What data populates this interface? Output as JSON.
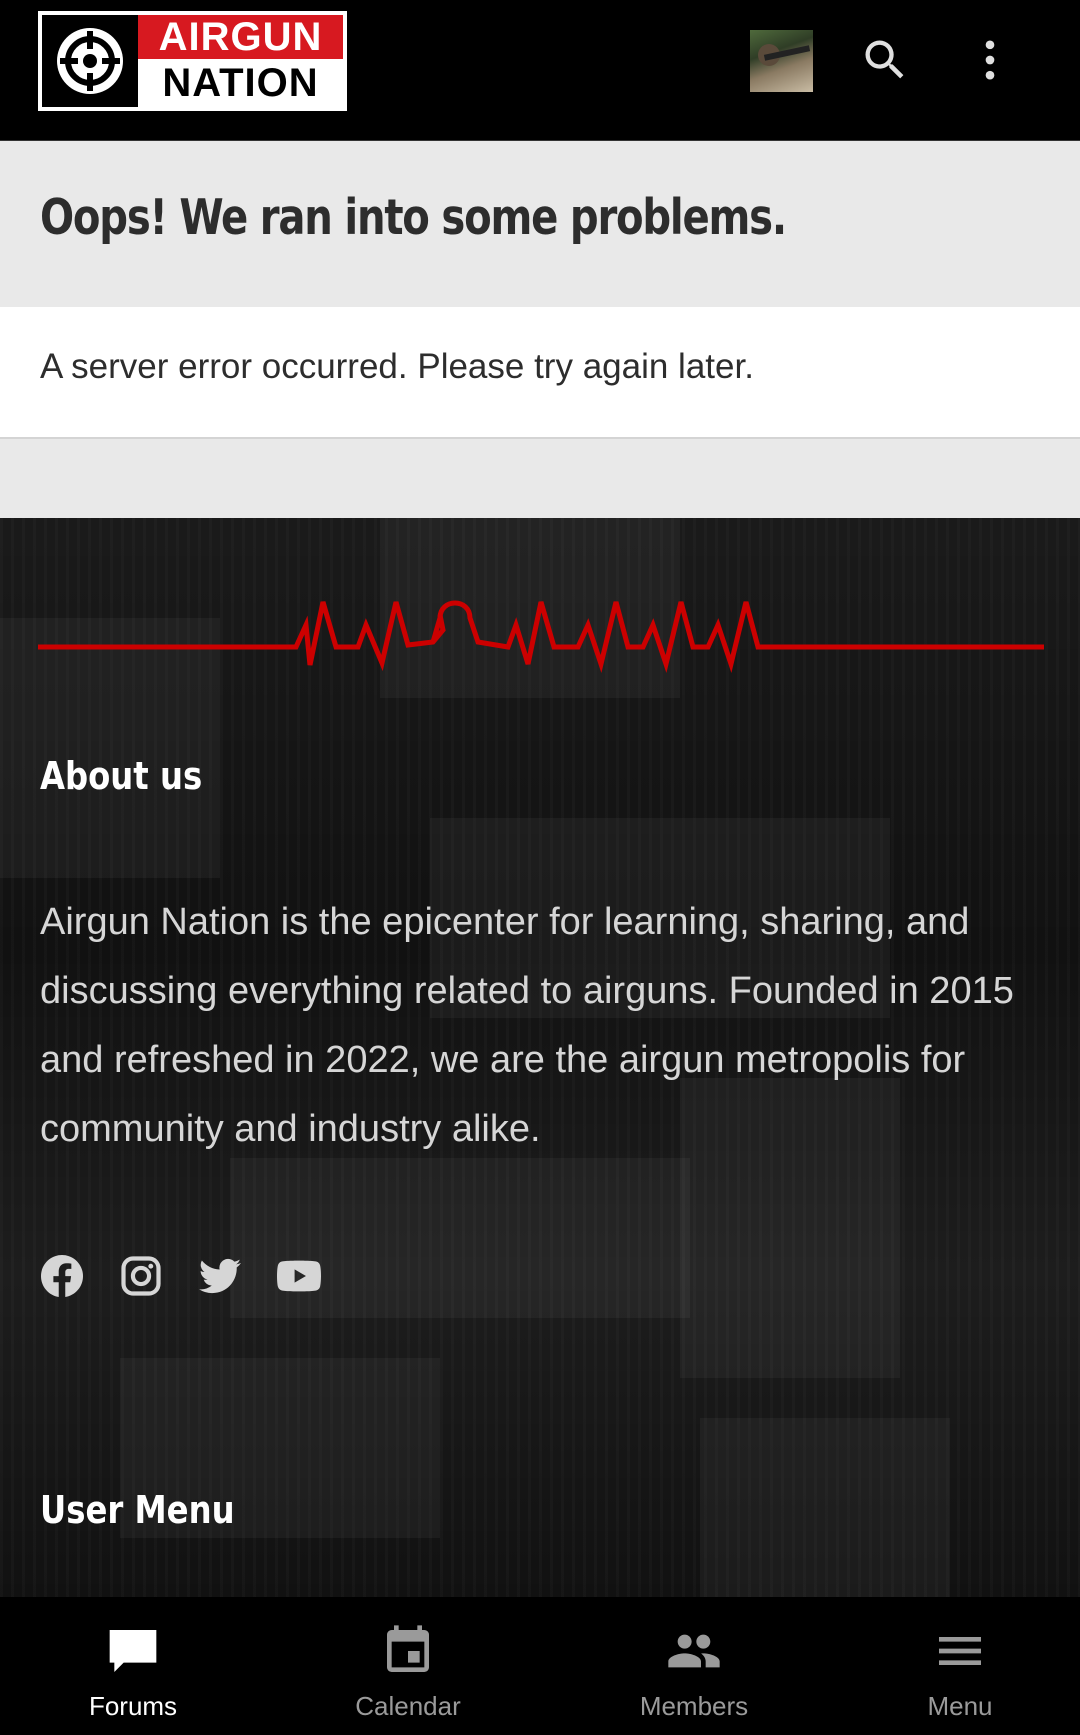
{
  "header": {
    "logo_line1": "AIRGUN",
    "logo_line2": "NATION",
    "icons": [
      "crosshair-icon",
      "avatar",
      "search-icon",
      "more-vert-icon"
    ],
    "colors": {
      "brand_red": "#d71920",
      "background": "#000000"
    }
  },
  "error": {
    "title": "Oops! We ran into some problems.",
    "message": "A server error occurred. Please try again later."
  },
  "footer": {
    "about_title": "About us",
    "about_text": "Airgun Nation is the epicenter for learning, sharing, and discussing everything related to airguns. Founded in 2015 and refreshed in 2022, we are the airgun metropolis for community and industry alike.",
    "social": [
      "facebook-icon",
      "instagram-icon",
      "twitter-icon",
      "youtube-icon"
    ],
    "user_menu_title": "User Menu",
    "accent_color": "#cc0000"
  },
  "bottom_nav": {
    "items": [
      {
        "label": "Forums",
        "icon": "chat-bubble-icon",
        "active": true
      },
      {
        "label": "Calendar",
        "icon": "calendar-icon",
        "active": false
      },
      {
        "label": "Members",
        "icon": "members-icon",
        "active": false
      },
      {
        "label": "Menu",
        "icon": "hamburger-icon",
        "active": false
      }
    ]
  }
}
